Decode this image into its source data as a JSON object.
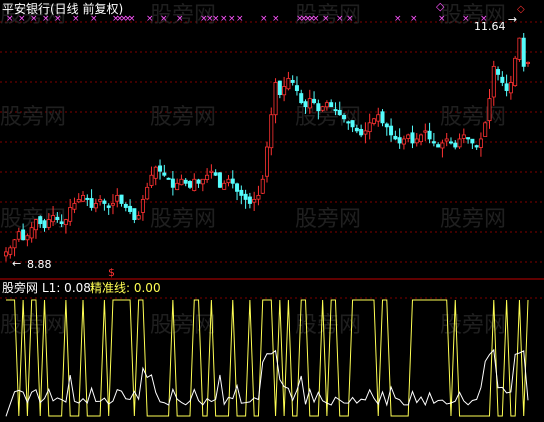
{
  "header": {
    "title": "平安银行(日线 前复权)",
    "title_color": "#ffffff"
  },
  "price_panel": {
    "high_label": "11.64",
    "low_label": "8.88",
    "arrow_right": "←",
    "arrow_left": "←",
    "cross_marker": "×",
    "signal_marker": "$",
    "diamond_marker": "◇"
  },
  "indicator_panel": {
    "name": "股旁网",
    "l1_label": "L1: 0.08",
    "jzx_label": "精准线: 0.00"
  },
  "watermark": {
    "text": "股旁网"
  },
  "colors": {
    "up": "#ff3232",
    "down": "#54fcfc",
    "white": "#ffffff",
    "yellow": "#ffff54",
    "magenta": "#ff54ff",
    "grid": "#800000",
    "separator": "#c00000"
  },
  "chart_data": {
    "type": "candlestick",
    "title": "平安银行(日线 前复权)",
    "high_marked": 11.64,
    "low_marked": 8.88,
    "close_series": [
      8.9,
      8.95,
      9.05,
      9.15,
      9.05,
      9.1,
      9.2,
      9.3,
      9.25,
      9.2,
      9.3,
      9.35,
      9.3,
      9.25,
      9.3,
      9.45,
      9.5,
      9.55,
      9.6,
      9.55,
      9.45,
      9.5,
      9.55,
      9.5,
      9.45,
      9.5,
      9.6,
      9.5,
      9.45,
      9.4,
      9.3,
      9.35,
      9.55,
      9.7,
      9.85,
      9.95,
      9.9,
      9.85,
      9.8,
      9.7,
      9.75,
      9.8,
      9.75,
      9.7,
      9.8,
      9.75,
      9.8,
      9.85,
      9.9,
      9.85,
      9.7,
      9.75,
      9.8,
      9.75,
      9.65,
      9.6,
      9.55,
      9.5,
      9.55,
      9.6,
      9.8,
      10.2,
      10.6,
      11.0,
      10.85,
      10.95,
      11.05,
      11.0,
      10.9,
      10.75,
      10.7,
      10.8,
      10.75,
      10.65,
      10.7,
      10.75,
      10.7,
      10.65,
      10.6,
      10.55,
      10.5,
      10.45,
      10.4,
      10.35,
      10.4,
      10.5,
      10.55,
      10.6,
      10.5,
      10.45,
      10.35,
      10.3,
      10.25,
      10.3,
      10.35,
      10.25,
      10.3,
      10.35,
      10.4,
      10.3,
      10.25,
      10.2,
      10.25,
      10.3,
      10.25,
      10.2,
      10.3,
      10.35,
      10.3,
      10.25,
      10.2,
      10.3,
      10.5,
      10.8,
      11.2,
      11.1,
      11.0,
      10.9,
      11.0,
      11.3,
      11.55,
      11.2,
      11.25
    ]
  }
}
